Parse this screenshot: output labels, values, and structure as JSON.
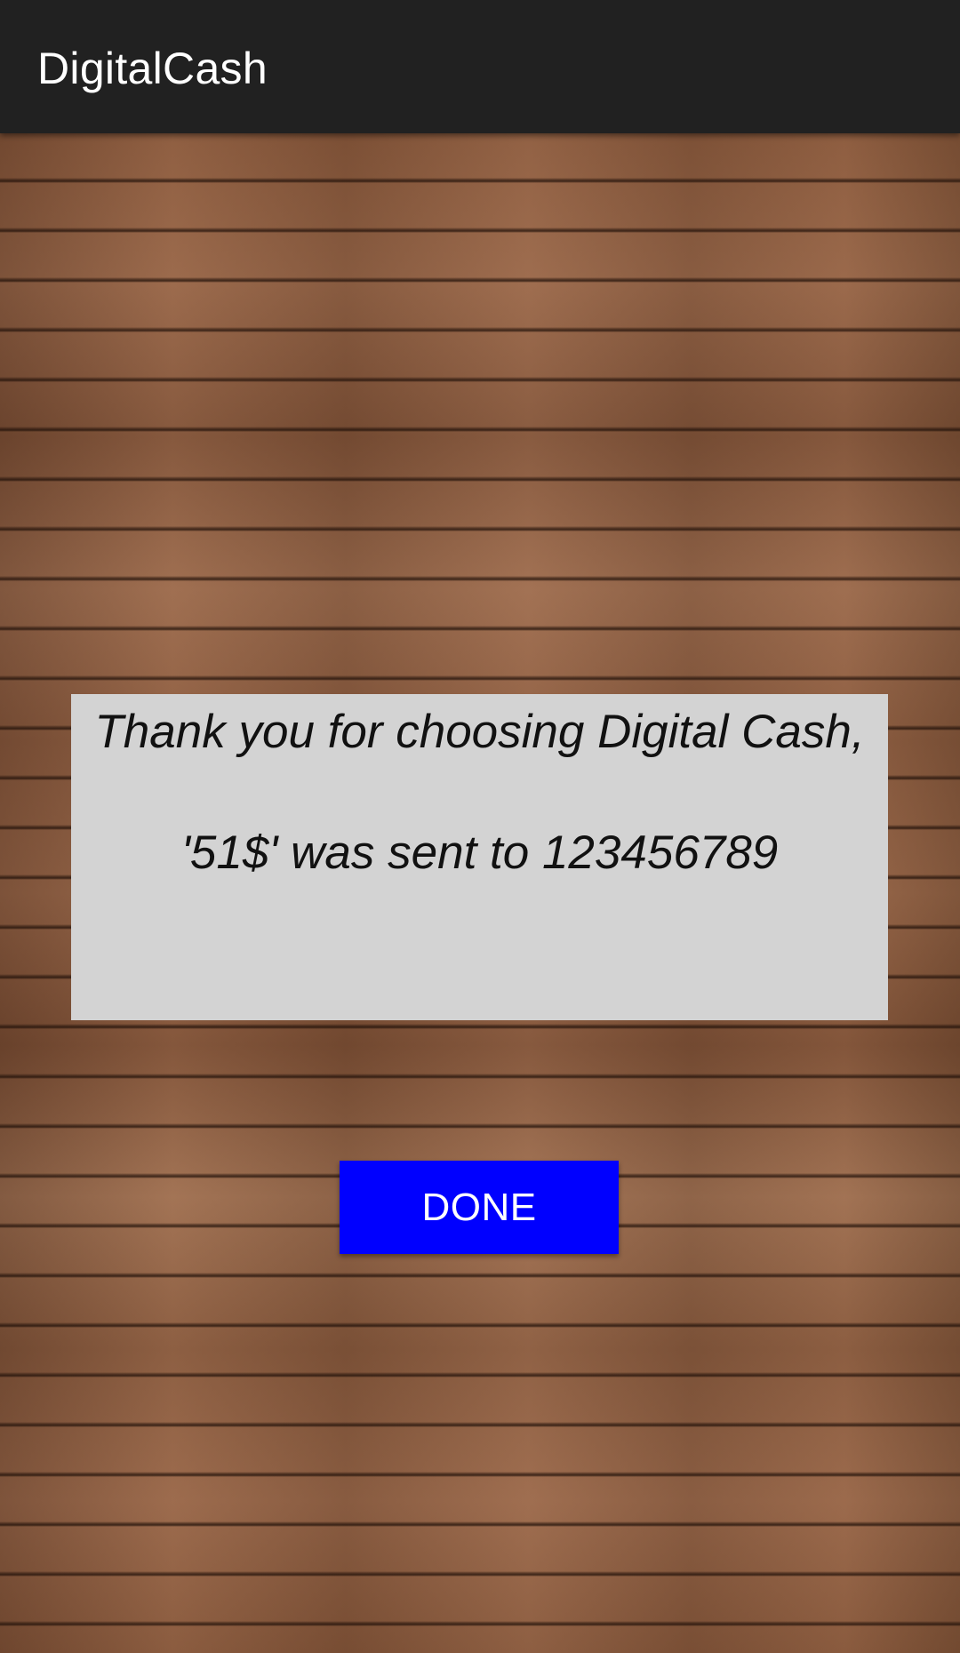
{
  "app_bar": {
    "title": "DigitalCash",
    "background_color": "#212121"
  },
  "message": {
    "line1": "Thank you for choosing Digital Cash,",
    "line2": "'51$' was sent to 123456789",
    "background_color": "#d3d3d3"
  },
  "done_button": {
    "label": "DONE",
    "color": "#0000ff"
  }
}
